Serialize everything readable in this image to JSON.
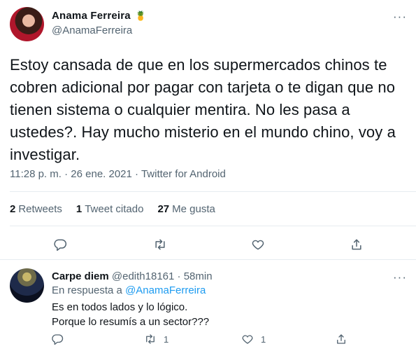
{
  "tweet": {
    "author_name": "Anama Ferreira",
    "author_emoji": "🍍",
    "author_handle": "@AnamaFerreira",
    "more": "···",
    "text": "Estoy cansada de que en los supermercados chinos te cobren adicional por pagar con tarjeta o te digan que no tienen sistema o cualquier mentira. No les pasa a ustedes?. Hay mucho misterio en el mundo chino, voy a investigar.",
    "time": "11:28 p. m.",
    "separator": "·",
    "date": "26 ene. 2021",
    "source": "Twitter for Android",
    "stats": {
      "retweets_count": "2",
      "retweets_label": "Retweets",
      "quotes_count": "1",
      "quotes_label": "Tweet citado",
      "likes_count": "27",
      "likes_label": "Me gusta"
    },
    "actions": {
      "reply_icon": "reply-icon",
      "retweet_icon": "retweet-icon",
      "like_icon": "heart-icon",
      "share_icon": "share-icon"
    }
  },
  "reply": {
    "author_name": "Carpe diem",
    "author_handle": "@edith18161",
    "separator": "·",
    "time": "58min",
    "more": "···",
    "in_reply_prefix": "En respuesta a",
    "in_reply_mention": "@AnamaFerreira",
    "line1": "Es en todos lados y lo lógico.",
    "line2": "Porque lo resumís a un sector???",
    "retweet_count": "1",
    "like_count": "1"
  },
  "colors": {
    "text": "#0f1419",
    "secondary": "#536471",
    "link": "#1d9bf0",
    "divider": "#e6ecf0"
  }
}
